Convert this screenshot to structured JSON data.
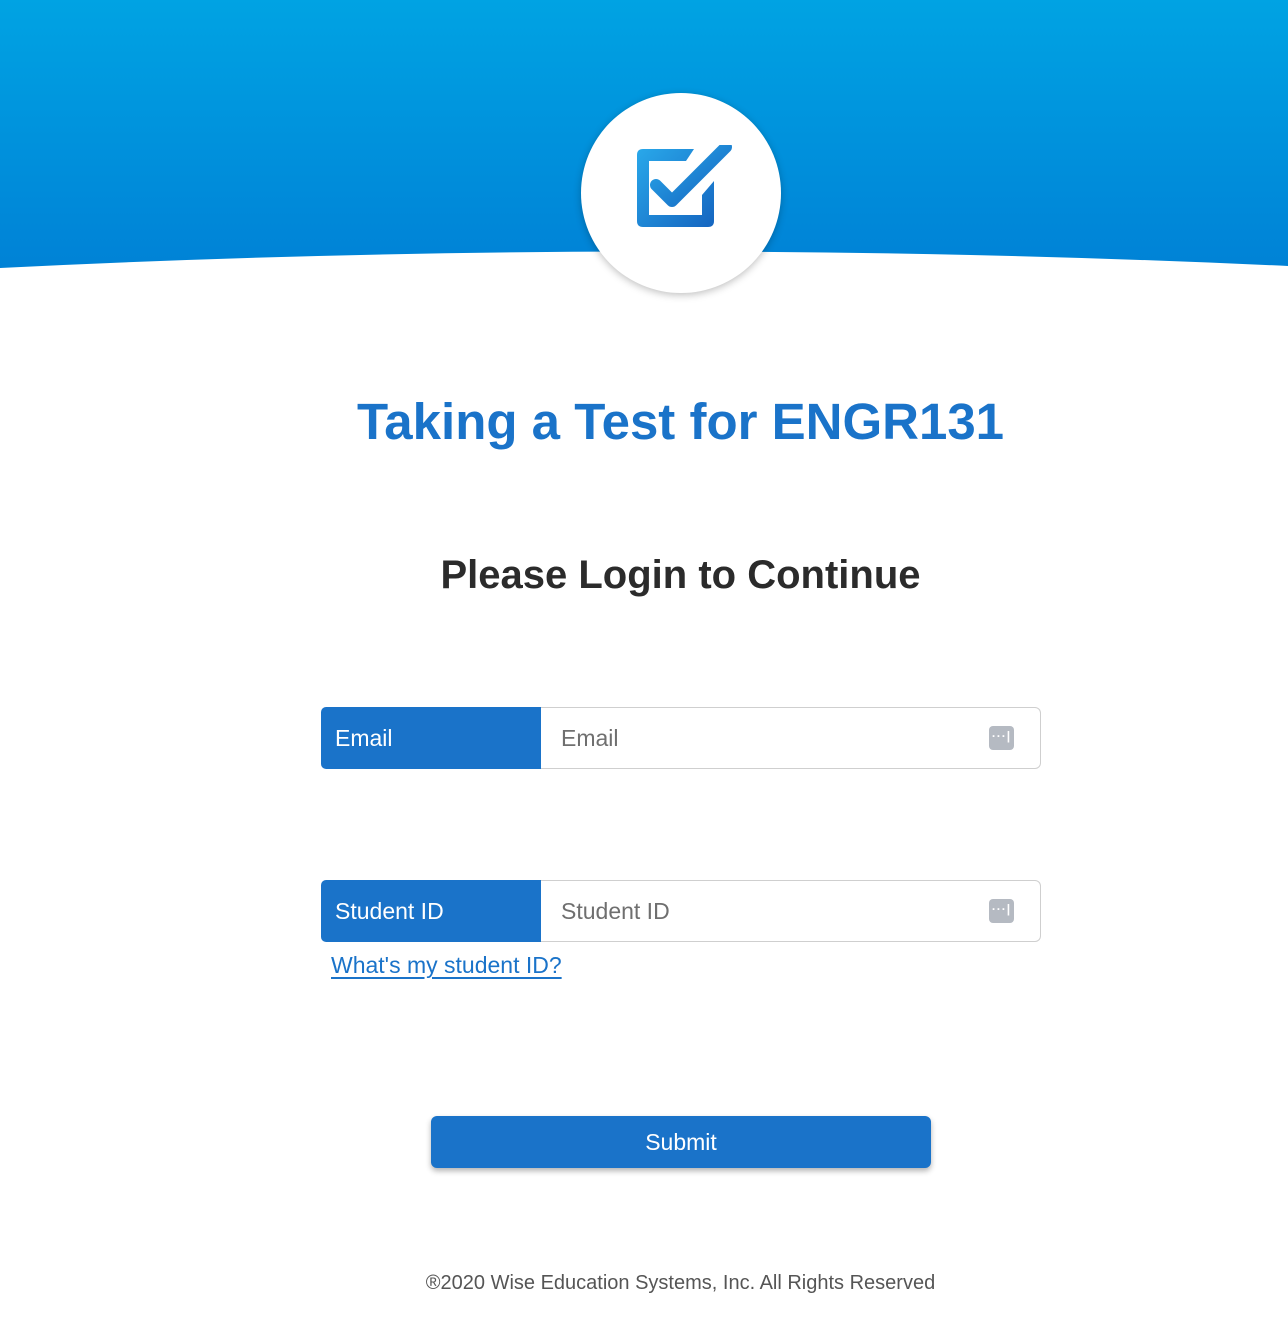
{
  "header": {
    "logo_icon": "checkbox-checked-icon",
    "gradient_top": "#00a3e3",
    "gradient_bottom": "#0082d6"
  },
  "main": {
    "title": "Taking a Test for ENGR131",
    "subtitle": "Please Login to Continue"
  },
  "form": {
    "email": {
      "label": "Email",
      "placeholder": "Email",
      "value": "",
      "icon": "password-manager-icon"
    },
    "student_id": {
      "label": "Student ID",
      "placeholder": "Student ID",
      "value": "",
      "icon": "password-manager-icon"
    },
    "help_link": "What's my student ID?",
    "submit_label": "Submit"
  },
  "footer": {
    "copyright": "®2020 Wise Education Systems, Inc. All Rights Reserved"
  },
  "colors": {
    "accent": "#1a73c9",
    "text_dark": "#2b2b2b",
    "footer_text": "#555555"
  }
}
